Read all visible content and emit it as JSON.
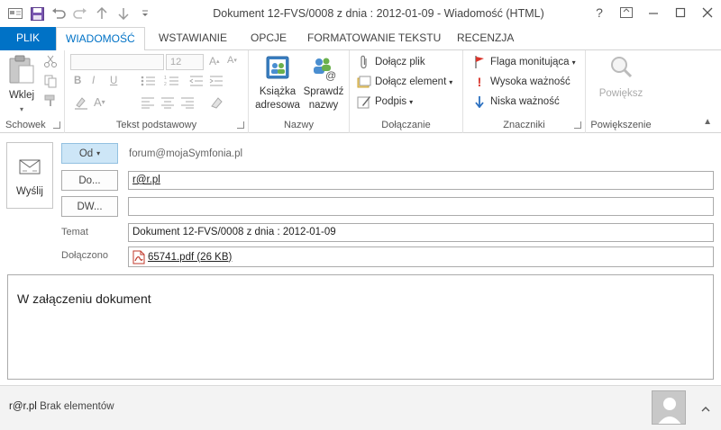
{
  "window": {
    "title": "Dokument 12-FVS/0008 z dnia : 2012-01-09 - Wiadomość (HTML)",
    "help": "?",
    "accent": "#0072c6"
  },
  "tabs": [
    {
      "label": "PLIK"
    },
    {
      "label": "WIADOMOŚĆ"
    },
    {
      "label": "WSTAWIANIE"
    },
    {
      "label": "OPCJE"
    },
    {
      "label": "FORMATOWANIE TEKSTU"
    },
    {
      "label": "RECENZJA"
    }
  ],
  "ribbon": {
    "clipboard": {
      "label": "Schowek",
      "paste": "Wklej"
    },
    "text": {
      "label": "Tekst podstawowy",
      "font_size": "12",
      "bold": "B",
      "italic": "I",
      "underline": "U"
    },
    "names": {
      "label": "Nazwy",
      "address_book": [
        "Książka",
        "adresowa"
      ],
      "check_names": [
        "Sprawdź",
        "nazwy"
      ]
    },
    "include": {
      "label": "Dołączanie",
      "attach_file": "Dołącz plik",
      "attach_item": "Dołącz element",
      "signature": "Podpis"
    },
    "tags": {
      "label": "Znaczniki",
      "follow_up": "Flaga monitująca",
      "high": "Wysoka ważność",
      "low": "Niska ważność"
    },
    "zoom": {
      "label": "Powiększenie",
      "zoom": "Powiększ"
    }
  },
  "compose": {
    "send": "Wyślij",
    "from_button": "Od",
    "from_value": "forum@mojaSymfonia.pl",
    "to_button": "Do...",
    "to_value": "r@r.pl",
    "cc_button": "DW...",
    "cc_value": "",
    "subject_label": "Temat",
    "subject_value": "Dokument 12-FVS/0008 z dnia : 2012-01-09",
    "attached_label": "Dołączono",
    "attachment": "65741.pdf (26 KB)",
    "body": "W załączeniu dokument"
  },
  "people_pane": {
    "name": "r@r.pl",
    "status": "Brak elementów"
  }
}
